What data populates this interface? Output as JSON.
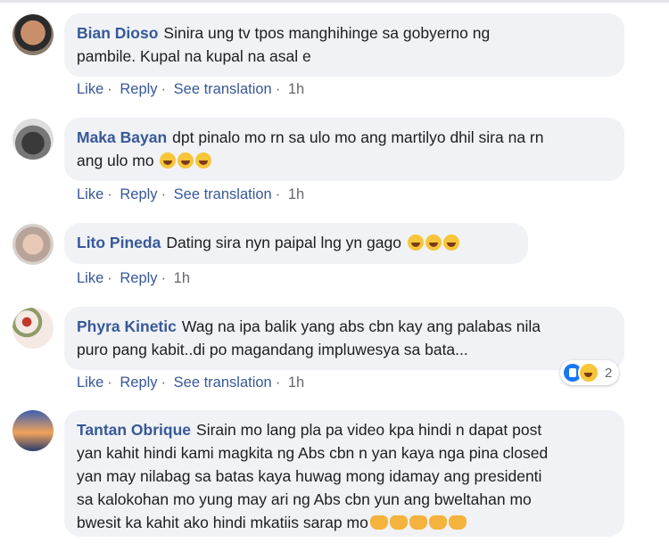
{
  "comments": [
    {
      "author": "Bian Dioso",
      "text_lines": [
        "Sinira ung tv tpos manghihinge sa gobyerno ng",
        "pambile. Kupal na kupal na asal e"
      ],
      "emojis": "",
      "actions": {
        "like": "Like",
        "reply": "Reply",
        "translate": "See translation",
        "time": "1h"
      }
    },
    {
      "author": "Maka Bayan",
      "text_lines": [
        "dpt pinalo mo rn sa ulo mo ang martilyo dhil sira na rn",
        "ang ulo mo"
      ],
      "emojis": "rolling-on-floor-laughing x3",
      "actions": {
        "like": "Like",
        "reply": "Reply",
        "translate": "See translation",
        "time": "1h"
      }
    },
    {
      "author": "Lito Pineda",
      "text_lines": [
        "Dating sira nyn paipal lng yn gago"
      ],
      "emojis": "grinning-squinting x2, rolling-on-floor-laughing x1",
      "actions": {
        "like": "Like",
        "reply": "Reply",
        "time": "1h"
      }
    },
    {
      "author": "Phyra Kinetic",
      "text_lines": [
        "Wag na ipa balik yang abs cbn kay ang palabas nila",
        "puro pang kabit..di po magandang impluwesya sa bata..."
      ],
      "reaction_count": "2",
      "actions": {
        "like": "Like",
        "reply": "Reply",
        "translate": "See translation",
        "time": "1h"
      }
    },
    {
      "author": "Tantan Obrique",
      "text_lines": [
        "Sirain mo lang pla pa video kpa hindi n dapat post",
        "yan kahit hindi kami magkita ng Abs cbn n yan kaya nga pina closed",
        "yan may nilabag sa batas kaya huwag mong idamay ang presidenti",
        "sa kalokohan mo yung may ari ng Abs cbn yun ang bweltahan mo",
        "bwesit ka kahit ako hindi mkatiis sarap mo"
      ],
      "emojis": "oncoming-fist x5"
    }
  ],
  "colors": {
    "link": "#385898",
    "bubble": "#f0f2f5",
    "meta": "#65676b"
  }
}
